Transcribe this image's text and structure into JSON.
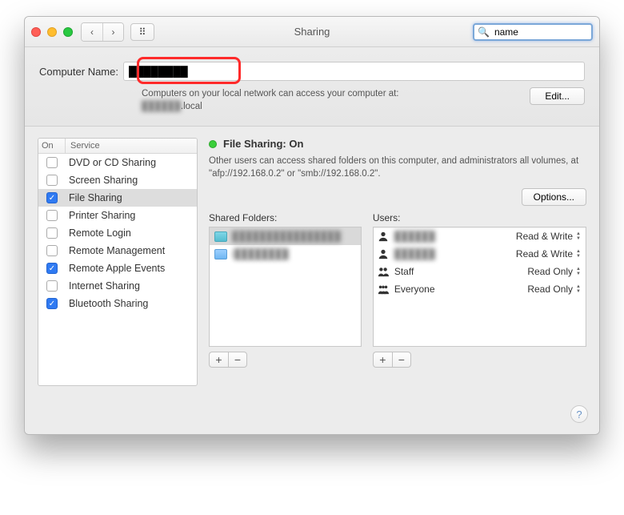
{
  "titlebar": {
    "title": "Sharing",
    "search_value": "name"
  },
  "computer": {
    "label": "Computer Name:",
    "value": "████████",
    "info_line1": "Computers on your local network can access your computer at:",
    "info_line2_suffix": ".local",
    "edit_label": "Edit..."
  },
  "services": {
    "header_on": "On",
    "header_service": "Service",
    "items": [
      {
        "label": "DVD or CD Sharing",
        "on": false,
        "selected": false
      },
      {
        "label": "Screen Sharing",
        "on": false,
        "selected": false
      },
      {
        "label": "File Sharing",
        "on": true,
        "selected": true
      },
      {
        "label": "Printer Sharing",
        "on": false,
        "selected": false
      },
      {
        "label": "Remote Login",
        "on": false,
        "selected": false
      },
      {
        "label": "Remote Management",
        "on": false,
        "selected": false
      },
      {
        "label": "Remote Apple Events",
        "on": true,
        "selected": false
      },
      {
        "label": "Internet Sharing",
        "on": false,
        "selected": false
      },
      {
        "label": "Bluetooth Sharing",
        "on": true,
        "selected": false
      }
    ]
  },
  "status": {
    "title": "File Sharing: On",
    "desc": "Other users can access shared folders on this computer, and administrators all volumes, at \"afp://192.168.0.2\" or \"smb://192.168.0.2\".",
    "options_label": "Options..."
  },
  "shared_folders": {
    "label": "Shared Folders:",
    "items": [
      {
        "name": "████████████████",
        "icon": "teal",
        "selected": true
      },
      {
        "name": "i████████",
        "icon": "blue",
        "selected": false
      }
    ]
  },
  "users": {
    "label": "Users:",
    "items": [
      {
        "name": "██████",
        "icon": "person",
        "perm": "Read & Write"
      },
      {
        "name": "██████",
        "icon": "person",
        "perm": "Read & Write"
      },
      {
        "name": "Staff",
        "icon": "pair",
        "perm": "Read Only"
      },
      {
        "name": "Everyone",
        "icon": "group",
        "perm": "Read Only"
      }
    ]
  },
  "buttons": {
    "plus": "+",
    "minus": "−"
  }
}
